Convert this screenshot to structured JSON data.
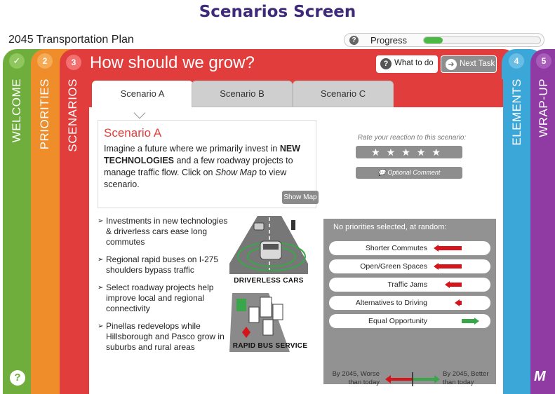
{
  "screen_title": "Scenarios Screen",
  "app_title": "2045 Transportation Plan",
  "progress": {
    "label": "Progress",
    "help_icon": "?",
    "fraction": 0.16
  },
  "panels": {
    "welcome": {
      "label": "WELCOME",
      "marker": "✓",
      "color": "#6fae3c"
    },
    "priorities": {
      "label": "PRIORITIES",
      "number": "2",
      "color": "#ef8d2b"
    },
    "scenarios": {
      "label": "SCENARIOS",
      "number": "3",
      "color": "#e23d3d"
    },
    "elements": {
      "label": "ELEMENTS",
      "number": "4",
      "color": "#3ba6d8"
    },
    "wrapup": {
      "label": "WRAP-UP",
      "number": "5",
      "color": "#8f3ba3"
    }
  },
  "main": {
    "title": "How should we grow?",
    "what_to_do": "What to do",
    "next_task": "Next Task"
  },
  "tabs": [
    {
      "label": "Scenario A",
      "active": true
    },
    {
      "label": "Scenario B",
      "active": false
    },
    {
      "label": "Scenario C",
      "active": false
    }
  ],
  "scenario": {
    "title": "Scenario A",
    "desc_1": "Imagine a future where we primarily invest in ",
    "desc_bold": "NEW TECHNOLOGIES",
    "desc_2": " and a few roadway projects to manage traffic flow. Click on ",
    "desc_italic": "Show Map",
    "desc_3": " to view scenario.",
    "show_map": "Show Map"
  },
  "rating": {
    "label": "Rate your reaction to this scenario:",
    "stars": "★★★★★",
    "comment": "Optional Comment"
  },
  "bullets": [
    "Investments in new technologies & driverless cars ease long commutes",
    "Regional rapid buses on I-275 shoulders bypass traffic",
    "Select roadway projects help improve local and regional connectivity",
    "Pinellas redevelops while Hillsborough and Pasco grow in suburbs and rural areas"
  ],
  "illustrations": {
    "driverless": "DRIVERLESS CARS",
    "bus": "RAPID BUS SERVICE"
  },
  "priorities": {
    "heading": "No priorities selected, at random:",
    "items": [
      {
        "label": "Shorter Commutes",
        "direction": "worse",
        "magnitude": 0.9
      },
      {
        "label": "Open/Green Spaces",
        "direction": "worse",
        "magnitude": 0.9
      },
      {
        "label": "Traffic Jams",
        "direction": "worse",
        "magnitude": 0.55
      },
      {
        "label": "Alternatives to Driving",
        "direction": "worse",
        "magnitude": 0.2
      },
      {
        "label": "Equal Opportunity",
        "direction": "better",
        "magnitude": 0.8
      }
    ],
    "colors": {
      "worse": "#d6141b",
      "better": "#3aa64a"
    },
    "legend_worse": "By 2045, Worse than today",
    "legend_better": "By 2045, Better than today"
  },
  "corner": {
    "help": "?",
    "logo": "M"
  }
}
